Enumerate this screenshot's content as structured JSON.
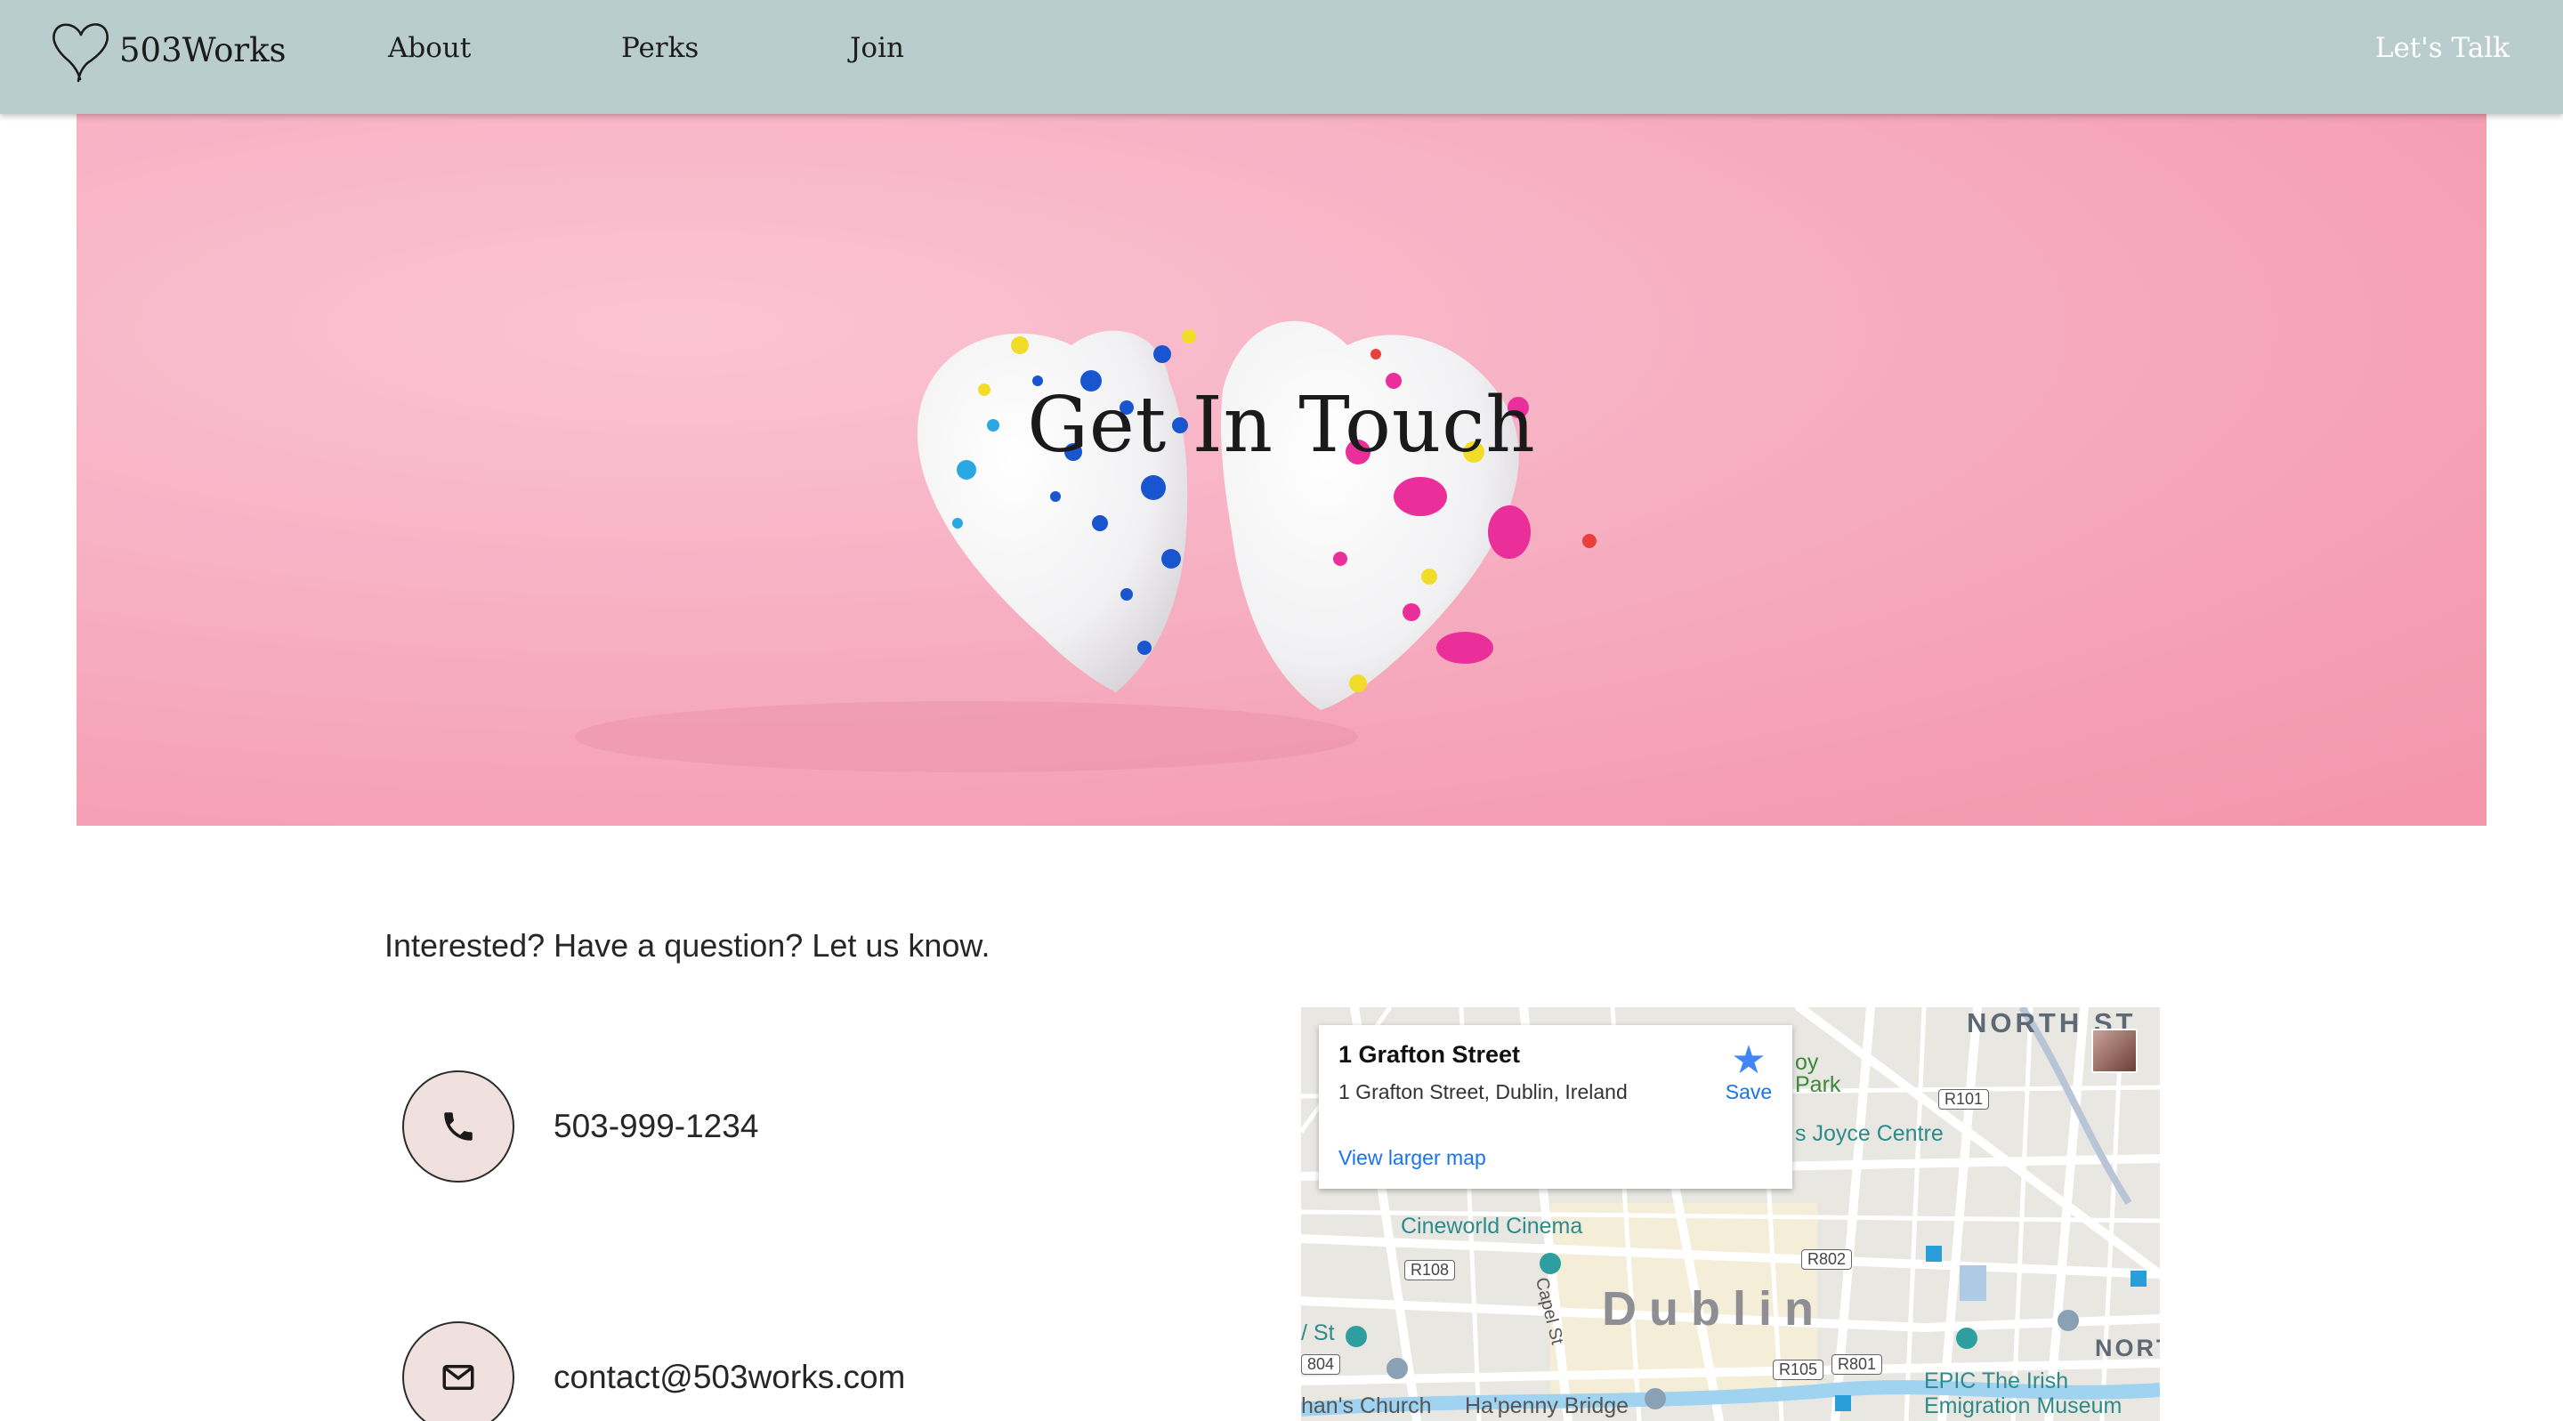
{
  "nav": {
    "brand": "503Works",
    "links": [
      "About",
      "Perks",
      "Join"
    ],
    "cta": "Let's Talk"
  },
  "hero": {
    "title": "Get In Touch"
  },
  "contact": {
    "intro": "Interested? Have a question? Let us know.",
    "phone": "503-999-1234",
    "email": "contact@503works.com",
    "icons": [
      "phone-icon",
      "envelope-icon"
    ]
  },
  "map": {
    "card": {
      "title": "1 Grafton Street",
      "address": "1 Grafton Street, Dublin, Ireland",
      "link": "View larger map",
      "save": "Save"
    },
    "labels": {
      "north_st": "NORTH ST",
      "north2": "NORT",
      "dublin": "Dublin",
      "cineworld": "Cineworld Cinema",
      "joyce": "s Joyce Centre",
      "park": "oy\nPark",
      "epic": "EPIC The Irish\nEmigration Museum",
      "church": "han's Church",
      "hapenny": "Ha'penny Bridge",
      "st": "/ St",
      "capel": "Capel St"
    },
    "road_shields": [
      "R101",
      "R108",
      "R802",
      "R105",
      "R801",
      "804"
    ],
    "colors": {
      "link": "#1a73e8",
      "star": "#4285f4",
      "poi": "#2e8b8b"
    }
  },
  "colors": {
    "nav_bg": "#b9cdcc",
    "hero_bg": "#f7b3c5",
    "icon_circle": "#f1e1de"
  }
}
